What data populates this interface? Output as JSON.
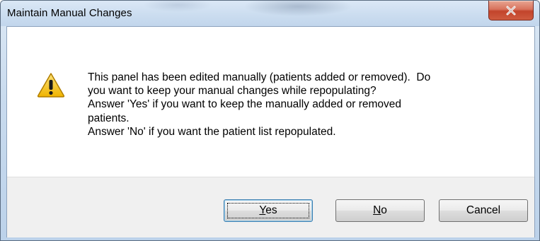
{
  "window": {
    "title": "Maintain Manual Changes"
  },
  "icons": {
    "close": "close-icon",
    "warning": "warning-icon"
  },
  "message": {
    "lines": [
      "This panel has been edited manually (patients added or removed).  Do",
      "you want to keep your manual changes while repopulating?",
      "Answer 'Yes' if you want to keep the manually added or removed",
      "patients.",
      "Answer 'No' if you want the patient list repopulated."
    ]
  },
  "buttons": {
    "yes": {
      "mnemonic": "Y",
      "rest": "es"
    },
    "no": {
      "mnemonic": "N",
      "rest": "o"
    },
    "cancel": {
      "label": "Cancel"
    }
  },
  "colors": {
    "close_button": "#c2442b",
    "warning_fill": "#f5c518",
    "default_button_border": "#3c7fb1"
  }
}
